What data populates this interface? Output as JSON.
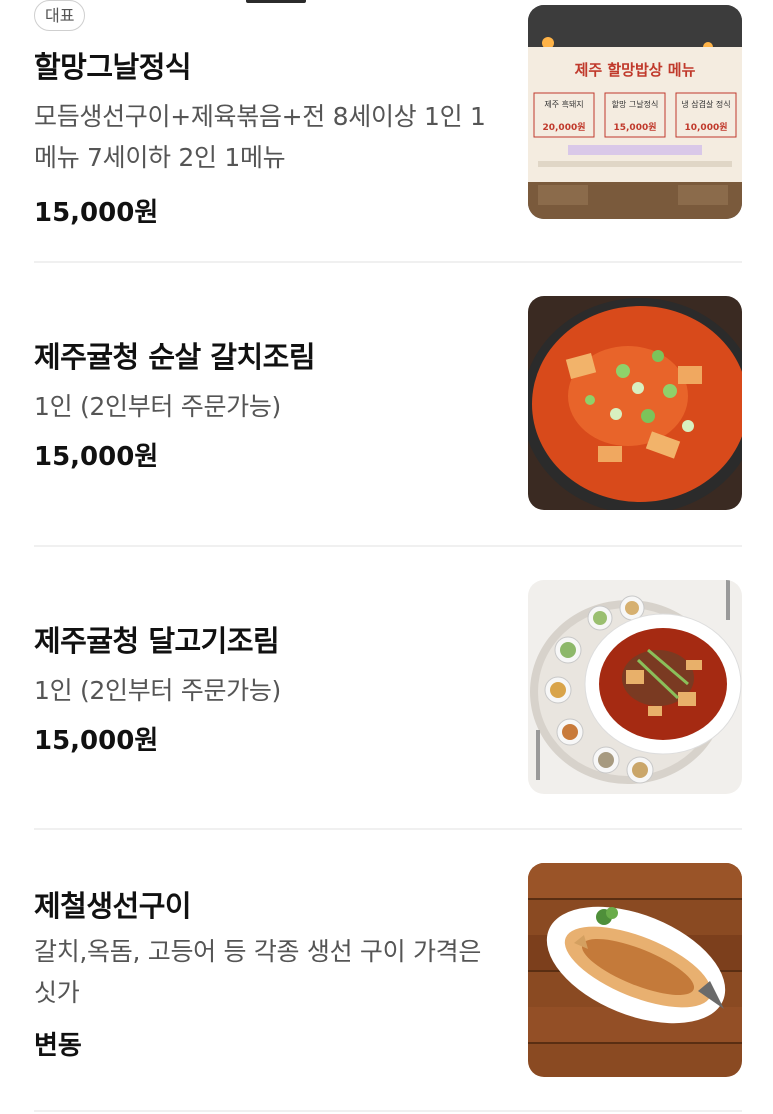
{
  "menu": {
    "items": [
      {
        "badge": "대표",
        "name": "할망그날정식",
        "description": "모듬생선구이+제육볶음+전 8세이상 1인 1메뉴 7세이하 2인 1메뉴",
        "price": "15,000원",
        "photo": "restaurant-menu-board-photo",
        "photo_sign": {
          "title": "제주 할망밥상 메뉴",
          "col1": "제주 흑돼지",
          "col2": "할망 그날정식",
          "col3": "냉 삼겹살 정식",
          "price1": "20,000원",
          "price2": "15,000원",
          "price3": "10,000원"
        }
      },
      {
        "name": "제주귤청 순살 갈치조림",
        "description": "1인 (2인부터 주문가능)",
        "price": "15,000원",
        "photo": "braised-cutlassfish-photo"
      },
      {
        "name": "제주귤청 달고기조림",
        "description": "1인 (2인부터 주문가능)",
        "price": "15,000원",
        "photo": "braised-john-dory-photo"
      },
      {
        "name": "제철생선구이",
        "description": "갈치,옥돔, 고등어 등 각종 생선 구이 가격은 싯가",
        "price": "변동",
        "photo": "grilled-fish-photo"
      }
    ]
  },
  "colors": {
    "text_primary": "#111111",
    "text_secondary": "#555555",
    "divider": "#f0f0f0",
    "badge_border": "#cfcfcf"
  }
}
